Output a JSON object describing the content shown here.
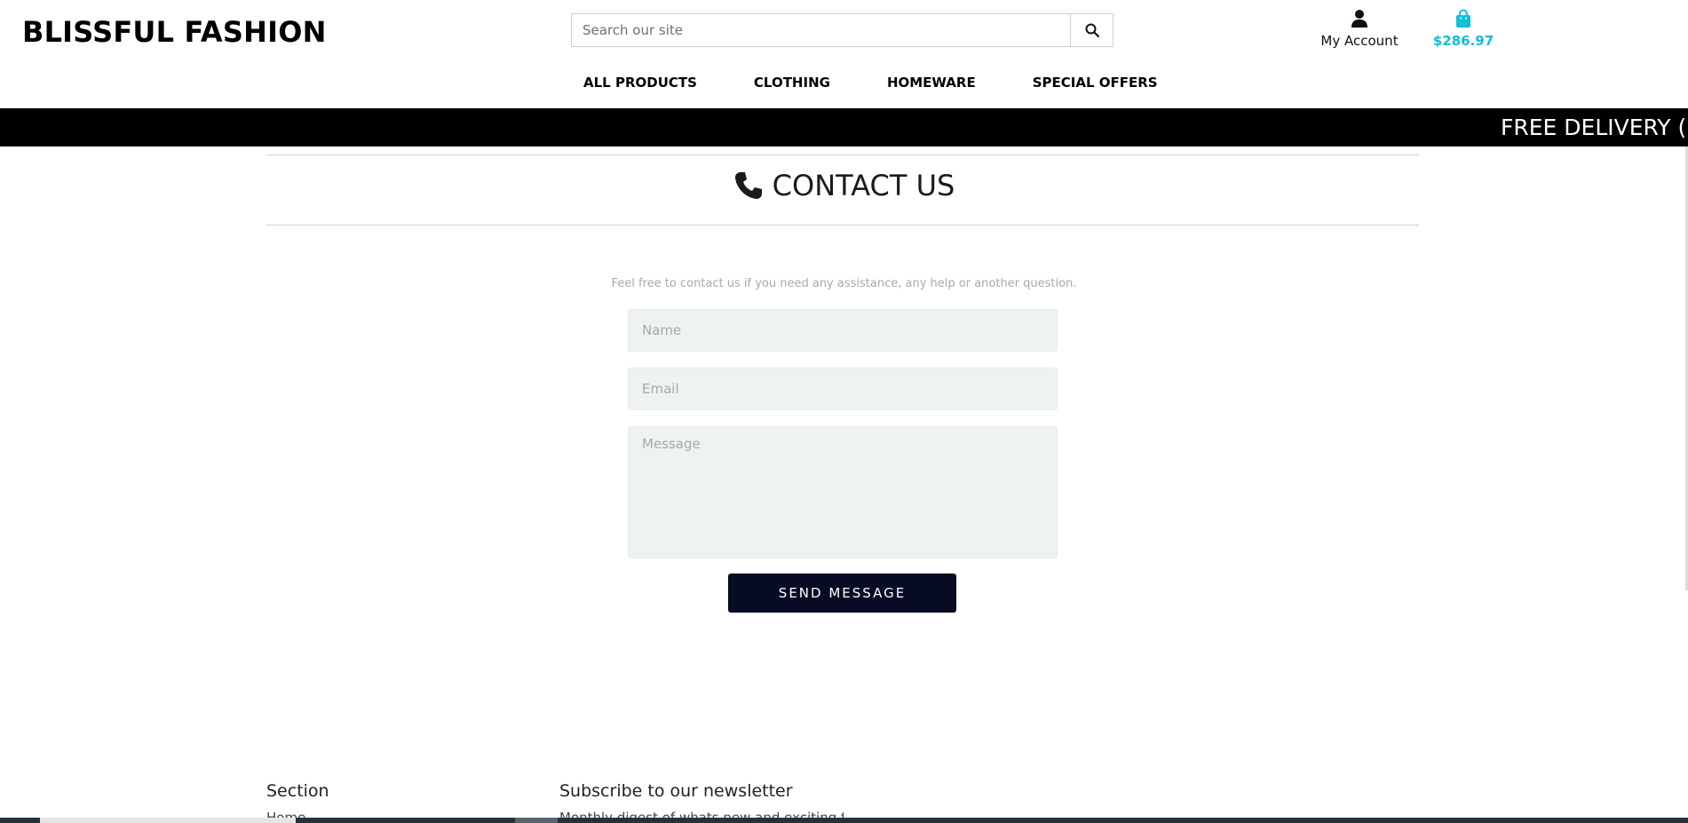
{
  "brand": {
    "logo_text": "BLISSFUL FASHION"
  },
  "search": {
    "placeholder": "Search our site",
    "icon": "search-icon"
  },
  "account": {
    "label": "My Account",
    "icon": "user-icon"
  },
  "bag": {
    "total": "$286.97",
    "icon": "shopping-bag-icon",
    "color": "#12bfd6"
  },
  "nav": {
    "items": [
      {
        "label": "ALL PRODUCTS"
      },
      {
        "label": "CLOTHING"
      },
      {
        "label": "HOMEWARE"
      },
      {
        "label": "SPECIAL OFFERS"
      }
    ]
  },
  "banner": {
    "text": "FREE DELIVERY (",
    "background": "#000000"
  },
  "contact": {
    "title": "CONTACT US",
    "icon": "phone-icon",
    "intro": "Feel free to contact us if you need any assistance, any help or another question.",
    "name_placeholder": "Name",
    "email_placeholder": "Email",
    "message_placeholder": "Message",
    "send_label": "SEND MESSAGE",
    "send_color": "#070b23"
  },
  "footer": {
    "section_heading": "Section",
    "section_first_item": "Home",
    "newsletter_heading": "Subscribe to our newsletter",
    "newsletter_text": "Monthly digest of whats new and exciting from us."
  }
}
